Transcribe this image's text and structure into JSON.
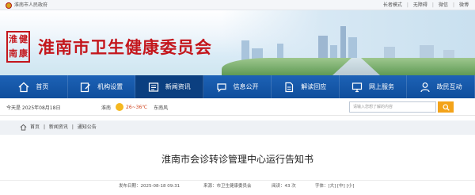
{
  "topbar": {
    "gov_name": "淮南市人民政府",
    "links": [
      "长者模式",
      "无障碍",
      "微信",
      "微博"
    ]
  },
  "banner": {
    "seal_chars": [
      "淮",
      "健",
      "南",
      "康"
    ],
    "site_title": "淮南市卫生健康委员会"
  },
  "nav": {
    "items": [
      {
        "label": "首页",
        "icon": "home-icon"
      },
      {
        "label": "机构设置",
        "icon": "edit-icon"
      },
      {
        "label": "新闻资讯",
        "icon": "news-icon"
      },
      {
        "label": "信息公开",
        "icon": "speech-bubble-icon"
      },
      {
        "label": "解读回应",
        "icon": "document-icon"
      },
      {
        "label": "网上服务",
        "icon": "monitor-icon"
      },
      {
        "label": "政民互动",
        "icon": "person-icon"
      }
    ],
    "active": "新闻资讯"
  },
  "infobar": {
    "date": "今天是 2025年08月18日",
    "city": "淮南",
    "temperature": "26~36℃",
    "wind": "东南风",
    "search_placeholder": "请输入您想了解的内容"
  },
  "breadcrumb": [
    "首页",
    "新闻资讯",
    "通知公告"
  ],
  "article": {
    "title": "淮南市会诊转诊管理中心运行告知书",
    "published": "发布日期：2025-08-18 09:31",
    "source": "来源：市卫生健康委员会",
    "views": "阅读：43 次",
    "font_size": "字体：[大] [中] [小]"
  },
  "colors": {
    "nav_blue": "#1a5aaa",
    "title_red": "#c4161c",
    "search_orange": "#f3a31a"
  }
}
